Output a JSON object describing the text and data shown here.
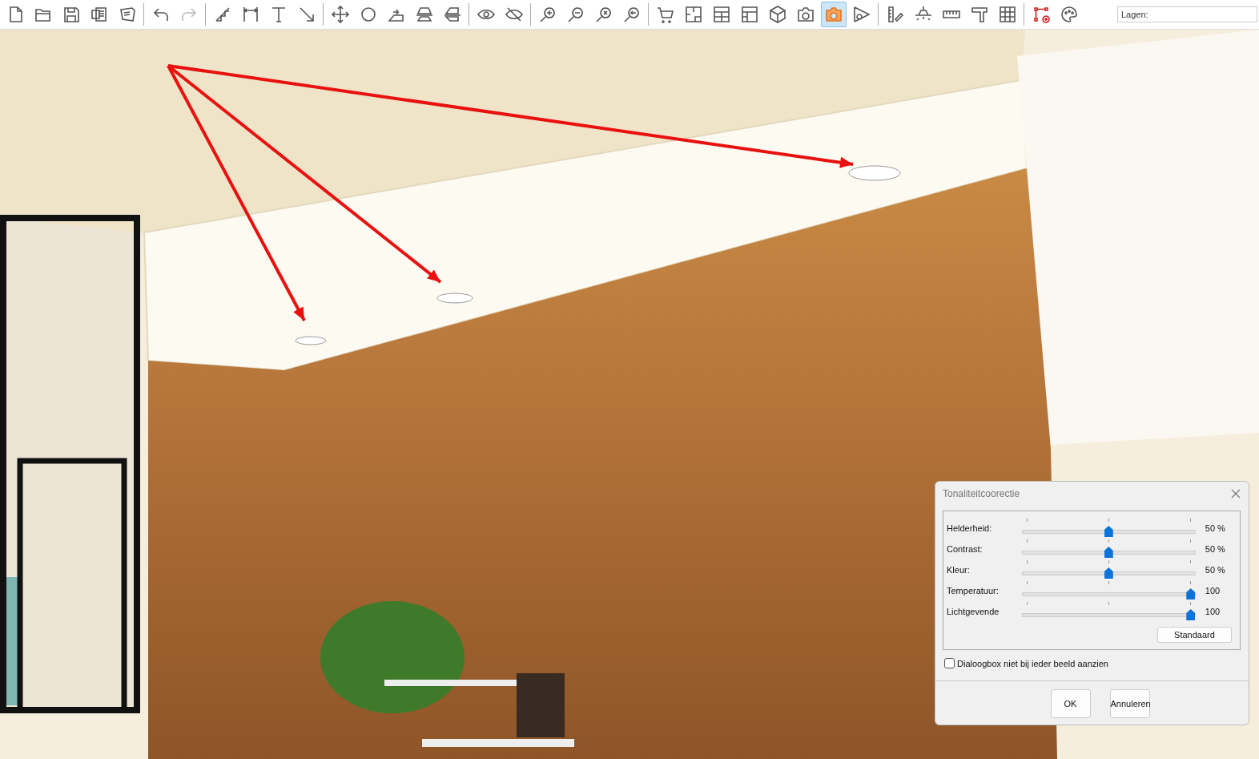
{
  "toolbar": {
    "groups": [
      [
        {
          "selected": false,
          "disabled": false
        },
        {
          "selected": false,
          "disabled": false
        },
        {
          "selected": false,
          "disabled": false
        },
        {
          "selected": false,
          "disabled": false
        },
        {
          "selected": false,
          "disabled": false
        }
      ],
      [
        {
          "selected": false,
          "disabled": false
        },
        {
          "selected": false,
          "disabled": true
        }
      ],
      [
        {
          "selected": false,
          "disabled": false
        },
        {
          "selected": false,
          "disabled": false
        },
        {
          "selected": false,
          "disabled": false
        },
        {
          "selected": false,
          "disabled": false
        }
      ],
      [
        {
          "selected": false,
          "disabled": false
        },
        {
          "selected": false,
          "disabled": false
        },
        {
          "selected": false,
          "disabled": false
        },
        {
          "selected": false,
          "disabled": false
        },
        {
          "selected": false,
          "disabled": false
        }
      ],
      [
        {
          "selected": false,
          "disabled": false
        },
        {
          "selected": false,
          "disabled": false
        }
      ],
      [
        {
          "selected": false,
          "disabled": false
        },
        {
          "selected": false,
          "disabled": false
        },
        {
          "selected": false,
          "disabled": false
        },
        {
          "selected": false,
          "disabled": false
        }
      ],
      [
        {
          "selected": false,
          "disabled": false
        },
        {
          "selected": false,
          "disabled": false
        },
        {
          "selected": false,
          "disabled": false
        },
        {
          "selected": false,
          "disabled": false
        },
        {
          "selected": false,
          "disabled": false
        },
        {
          "selected": false,
          "disabled": false
        },
        {
          "selected": true,
          "disabled": false
        },
        {
          "selected": false,
          "disabled": false
        }
      ],
      [
        {
          "selected": false,
          "disabled": false
        },
        {
          "selected": false,
          "disabled": false
        },
        {
          "selected": false,
          "disabled": false
        },
        {
          "selected": false,
          "disabled": false
        },
        {
          "selected": false,
          "disabled": false
        }
      ],
      [
        {
          "selected": false,
          "disabled": false
        },
        {
          "selected": false,
          "disabled": false
        }
      ]
    ],
    "layers_label": "Lagen:"
  },
  "dialog": {
    "title": "Tonaliteitcoorectie",
    "sliders": [
      {
        "label": "Helderheid:",
        "level": 0.5,
        "reading": "50 %"
      },
      {
        "label": "Contrast:",
        "level": 0.5,
        "reading": "50 %"
      },
      {
        "label": "Kleur:",
        "level": 0.5,
        "reading": "50 %"
      },
      {
        "label": "Temperatuur:",
        "level": 1,
        "reading": "100"
      },
      {
        "label": "Lichtgevende",
        "level": 1,
        "reading": "100"
      }
    ],
    "reset_button": "Standaard",
    "checkbox": {
      "label": "Dialoogbox niet bij ieder beeld aanzien",
      "checked": false
    },
    "buttons": [
      "OK",
      "Annuleren"
    ]
  }
}
